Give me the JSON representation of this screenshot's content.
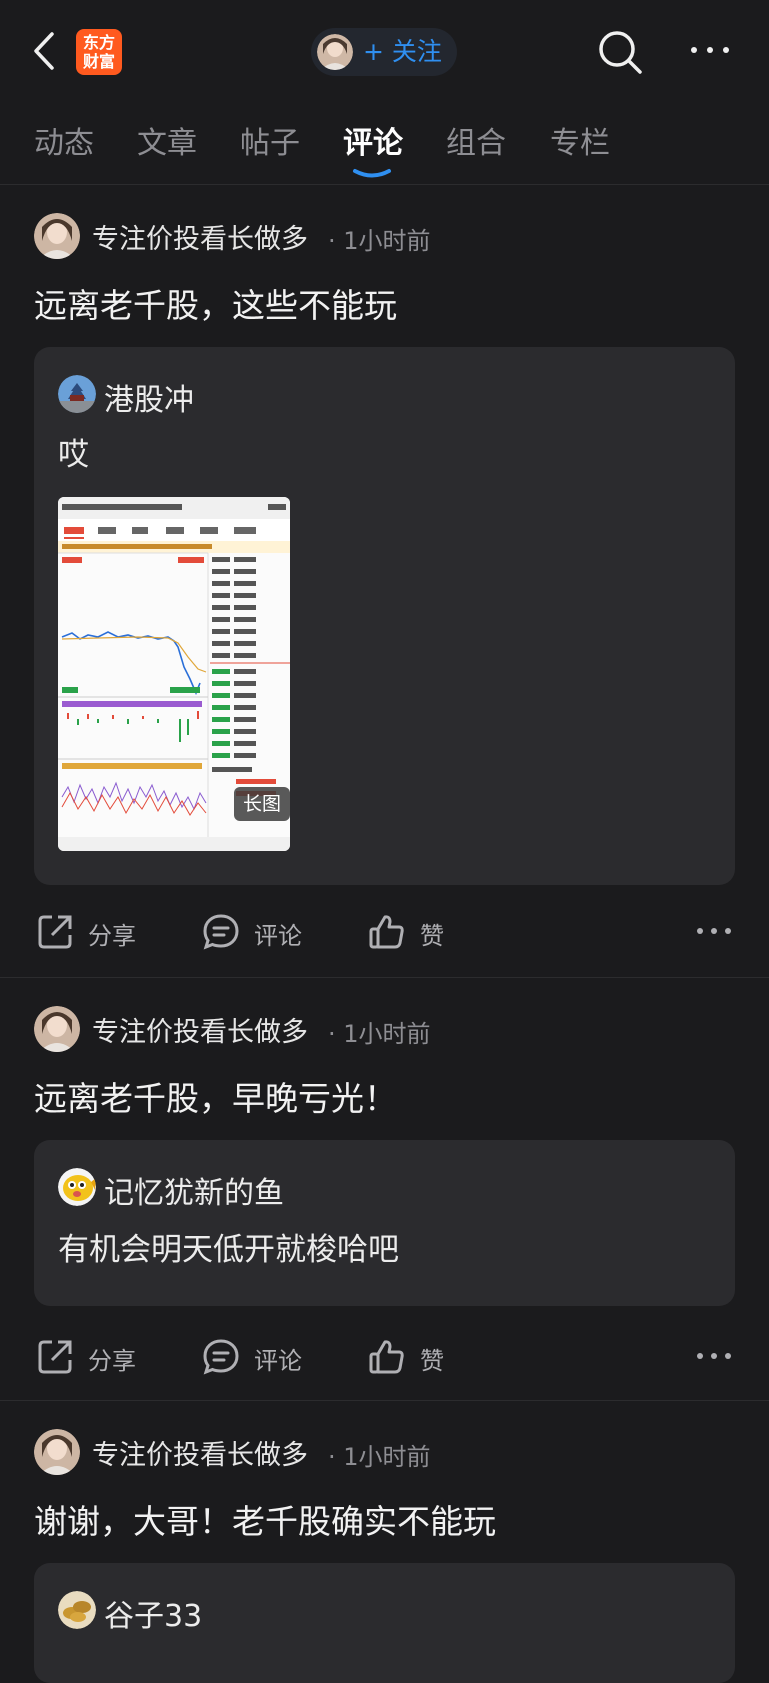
{
  "header": {
    "logo_line1": "东方",
    "logo_line2": "财富",
    "follow_label": "+ 关注"
  },
  "tabs": [
    {
      "label": "动态"
    },
    {
      "label": "文章"
    },
    {
      "label": "帖子"
    },
    {
      "label": "评论",
      "active": true
    },
    {
      "label": "组合"
    },
    {
      "label": "专栏"
    }
  ],
  "posts": [
    {
      "author": "专注价投看长做多",
      "time": "· 1小时前",
      "text": "远离老千股，这些不能玩",
      "quote": {
        "name": "港股冲",
        "text": "哎",
        "image_tag": "长图",
        "image_label": "stock chart screenshot"
      },
      "actions": {
        "share": "分享",
        "comment": "评论",
        "like": "赞"
      }
    },
    {
      "author": "专注价投看长做多",
      "time": "· 1小时前",
      "text": "远离老千股，早晚亏光！",
      "quote": {
        "name": "记忆犹新的鱼",
        "text": "有机会明天低开就梭哈吧"
      },
      "actions": {
        "share": "分享",
        "comment": "评论",
        "like": "赞"
      }
    },
    {
      "author": "专注价投看长做多",
      "time": "· 1小时前",
      "text": "谢谢，大哥！老千股确实不能玩",
      "quote": {
        "name": "谷子33"
      }
    }
  ],
  "colors": {
    "background": "#1b1b1d",
    "card": "#2b2b2e",
    "accent": "#2f8ff0",
    "logo": "#ff5a1f"
  }
}
